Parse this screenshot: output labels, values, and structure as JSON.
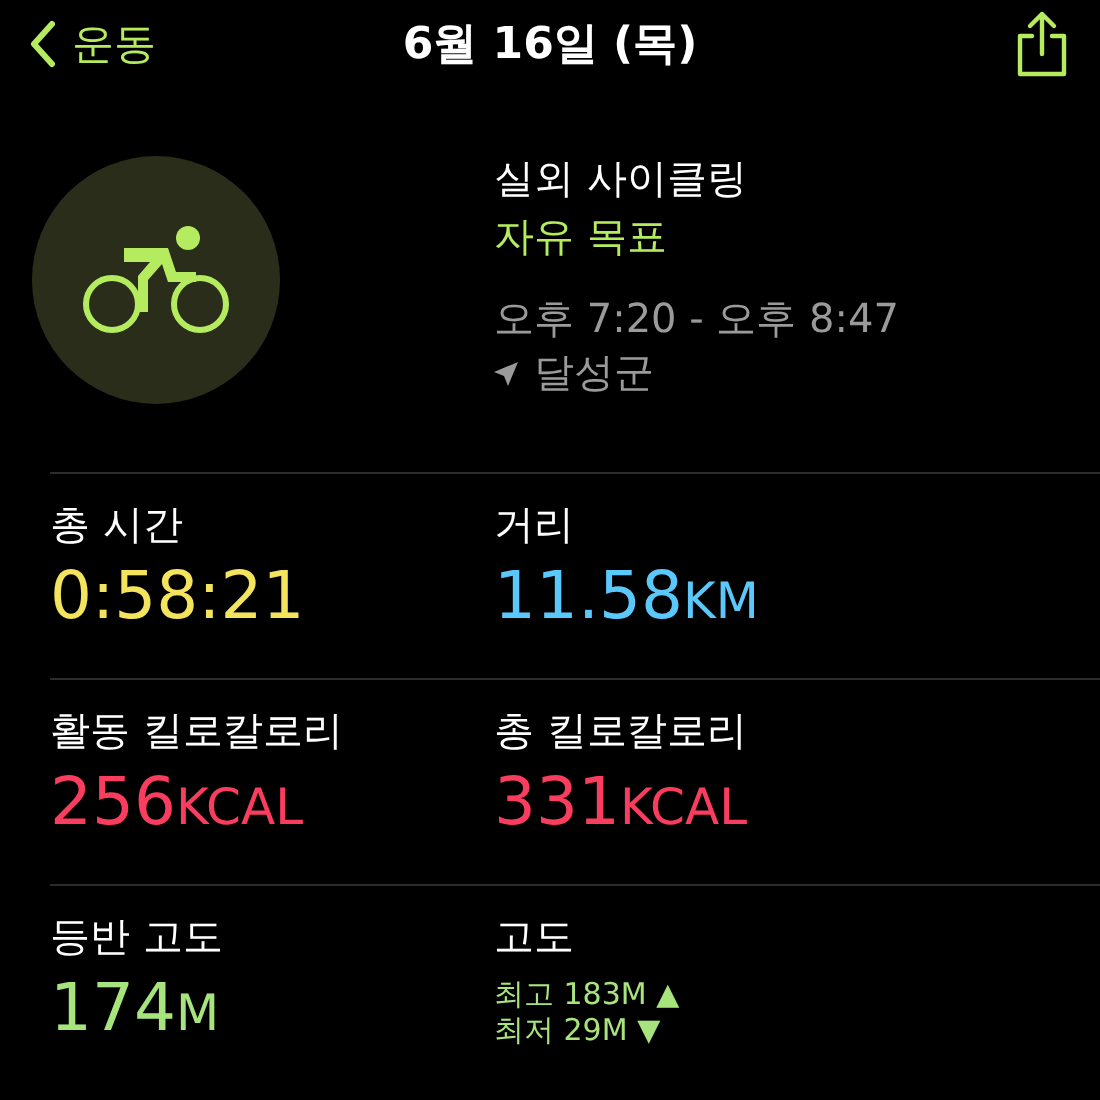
{
  "nav": {
    "back_label": "운동",
    "title": "6월 16일 (목)"
  },
  "workout": {
    "name": "실외 사이클링",
    "goal": "자유 목표",
    "time_range": "오후 7:20 - 오후 8:47",
    "location": "달성군"
  },
  "metrics": [
    {
      "kind": "value",
      "label": "총 시간",
      "value": "0:58:21",
      "color": "#f4e35c"
    },
    {
      "kind": "value",
      "label": "거리",
      "value": "11.58",
      "unit": "KM",
      "color": "#5ac8fa"
    },
    {
      "kind": "value",
      "label": "활동 킬로칼로리",
      "value": "256",
      "unit": "KCAL",
      "color": "#fa3d5f"
    },
    {
      "kind": "value",
      "label": "총 킬로칼로리",
      "value": "331",
      "unit": "KCAL",
      "color": "#fa3d5f"
    },
    {
      "kind": "value",
      "label": "등반 고도",
      "value": "174",
      "unit": "M",
      "color": "#a8e47e"
    },
    {
      "kind": "range",
      "label": "고도",
      "color": "#a8e47e",
      "lines": [
        {
          "text": "최고 183M",
          "arrow": "▲"
        },
        {
          "text": "최저 29M",
          "arrow": "▼"
        }
      ]
    }
  ]
}
